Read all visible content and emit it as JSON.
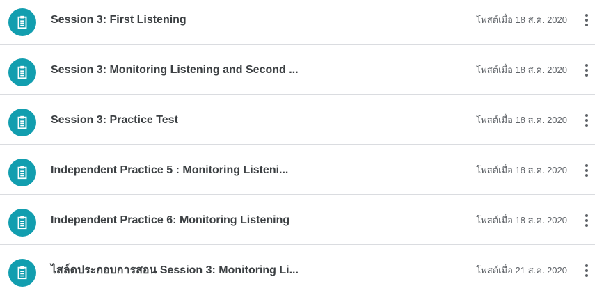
{
  "stream": {
    "items": [
      {
        "title": "Session 3: First Listening",
        "posted": "โพสต์เมื่อ 18 ส.ค. 2020",
        "icon": "assignment-icon"
      },
      {
        "title": "Session 3: Monitoring Listening and Second ...",
        "posted": "โพสต์เมื่อ 18 ส.ค. 2020",
        "icon": "assignment-icon"
      },
      {
        "title": "Session 3: Practice Test",
        "posted": "โพสต์เมื่อ 18 ส.ค. 2020",
        "icon": "assignment-icon"
      },
      {
        "title": "Independent Practice 5 : Monitoring Listeni...",
        "posted": "โพสต์เมื่อ 18 ส.ค. 2020",
        "icon": "assignment-icon"
      },
      {
        "title": "Independent Practice 6: Monitoring Listening",
        "posted": "โพสต์เมื่อ 18 ส.ค. 2020",
        "icon": "assignment-icon"
      },
      {
        "title": "ไสล์ดประกอบการสอน Session 3: Monitoring Li...",
        "posted": "โพสต์เมื่อ 21 ส.ค. 2020",
        "icon": "assignment-icon"
      }
    ]
  },
  "colors": {
    "accent": "#129eaf",
    "title_text": "#3c4043",
    "meta_text": "#5f6368",
    "divider": "#dadce0"
  }
}
